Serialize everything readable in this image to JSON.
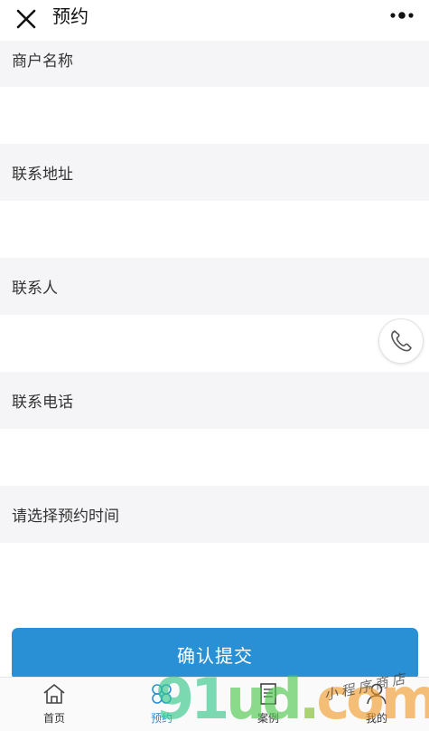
{
  "header": {
    "title": "预约",
    "close_icon": "close-icon",
    "more_icon": "more-dots-icon"
  },
  "form": {
    "fields": [
      {
        "label": "商户名称",
        "value": ""
      },
      {
        "label": "联系地址",
        "value": ""
      },
      {
        "label": "联系人",
        "value": ""
      },
      {
        "label": "联系电话",
        "value": ""
      },
      {
        "label": "请选择预约时间",
        "value": ""
      }
    ],
    "submit_label": "确认提交"
  },
  "floating": {
    "phone_icon": "phone-icon"
  },
  "tabbar": {
    "items": [
      {
        "label": "首页",
        "icon": "home-icon",
        "active": false
      },
      {
        "label": "预约",
        "icon": "clover-icon",
        "active": true
      },
      {
        "label": "案例",
        "icon": "document-icon",
        "active": false
      },
      {
        "label": "我的",
        "icon": "user-icon",
        "active": false
      }
    ]
  },
  "watermark": {
    "brand": "91ud.com",
    "tagline": "小程序商店"
  },
  "colors": {
    "accent": "#2a90d6",
    "label_background": "#f5f5f7",
    "input_background": "#ffffff"
  }
}
